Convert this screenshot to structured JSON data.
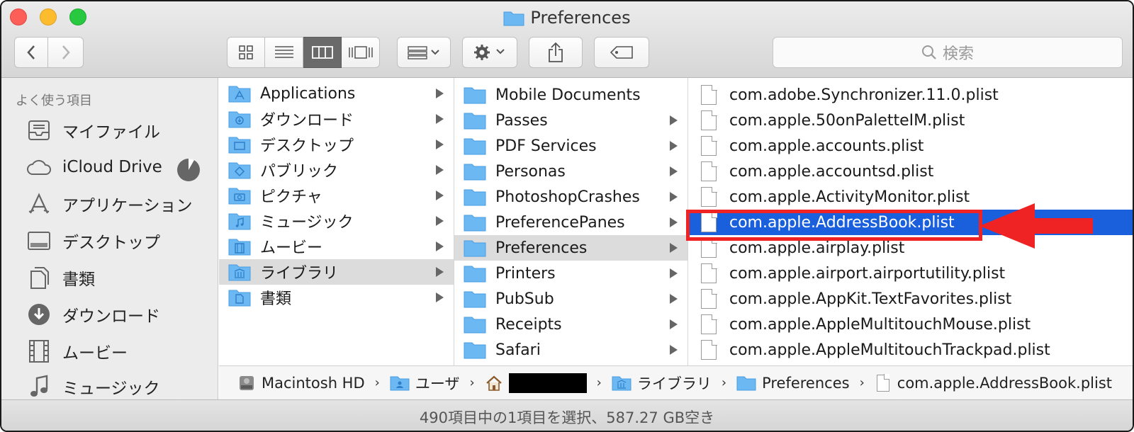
{
  "window": {
    "title": "Preferences"
  },
  "search": {
    "placeholder": "検索"
  },
  "sidebar": {
    "header": "よく使う項目",
    "items": [
      {
        "label": "マイファイル",
        "icon": "all-my-files-icon"
      },
      {
        "label": "iCloud Drive",
        "icon": "cloud-icon"
      },
      {
        "label": "アプリケーション",
        "icon": "applications-icon"
      },
      {
        "label": "デスクトップ",
        "icon": "desktop-icon"
      },
      {
        "label": "書類",
        "icon": "documents-icon"
      },
      {
        "label": "ダウンロード",
        "icon": "downloads-icon"
      },
      {
        "label": "ムービー",
        "icon": "movies-icon"
      },
      {
        "label": "ミュージック",
        "icon": "music-icon"
      }
    ]
  },
  "column1": {
    "items": [
      {
        "label": "Applications"
      },
      {
        "label": "ダウンロード"
      },
      {
        "label": "デスクトップ"
      },
      {
        "label": "パブリック"
      },
      {
        "label": "ピクチャ"
      },
      {
        "label": "ミュージック"
      },
      {
        "label": "ムービー"
      },
      {
        "label": "ライブラリ"
      },
      {
        "label": "書類"
      }
    ]
  },
  "column2": {
    "items": [
      {
        "label": "Mobile Documents"
      },
      {
        "label": "Passes"
      },
      {
        "label": "PDF Services"
      },
      {
        "label": "Personas"
      },
      {
        "label": "PhotoshopCrashes"
      },
      {
        "label": "PreferencePanes"
      },
      {
        "label": "Preferences"
      },
      {
        "label": "Printers"
      },
      {
        "label": "PubSub"
      },
      {
        "label": "Receipts"
      },
      {
        "label": "Safari"
      }
    ]
  },
  "column3": {
    "items": [
      {
        "label": "com.adobe.Synchronizer.11.0.plist"
      },
      {
        "label": "com.apple.50onPaletteIM.plist"
      },
      {
        "label": "com.apple.accounts.plist"
      },
      {
        "label": "com.apple.accountsd.plist"
      },
      {
        "label": "com.apple.ActivityMonitor.plist"
      },
      {
        "label": "com.apple.AddressBook.plist"
      },
      {
        "label": "com.apple.airplay.plist"
      },
      {
        "label": "com.apple.airport.airportutility.plist"
      },
      {
        "label": "com.apple.AppKit.TextFavorites.plist"
      },
      {
        "label": "com.apple.AppleMultitouchMouse.plist"
      },
      {
        "label": "com.apple.AppleMultitouchTrackpad.plist"
      }
    ]
  },
  "pathbar": {
    "crumbs": [
      "Macintosh HD",
      "ユーザ",
      "ライブラリ",
      "Preferences",
      "com.apple.AddressBook.plist"
    ]
  },
  "status": {
    "text": "490項目中の1項目を選択、587.27 GB空き"
  },
  "colors": {
    "selection": "#1a5fdc",
    "annotation": "#ef2323",
    "folder": "#6cb8f2"
  }
}
